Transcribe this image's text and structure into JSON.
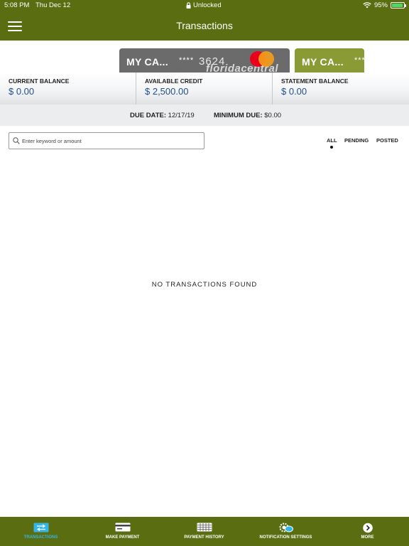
{
  "status_bar": {
    "time": "5:08 PM",
    "date": "Thu Dec 12",
    "lock_text": "Unlocked",
    "battery": "95%",
    "battery_level": 0.95
  },
  "header": {
    "title": "Transactions"
  },
  "cards": [
    {
      "name": "MY CA...",
      "mask": "****",
      "last4": "3624",
      "brand": "floridacentral"
    },
    {
      "name": "MY CA...",
      "mask": "***"
    }
  ],
  "balances": [
    {
      "label": "CURRENT BALANCE",
      "value": "$ 0.00"
    },
    {
      "label": "AVAILABLE CREDIT",
      "value": "$ 2,500.00"
    },
    {
      "label": "STATEMENT BALANCE",
      "value": "$ 0.00"
    }
  ],
  "due": {
    "due_label": "DUE DATE:",
    "due_value": "12/17/19",
    "min_label": "MINIMUM DUE:",
    "min_value": "$0.00"
  },
  "search": {
    "placeholder": "Enter keyword or amount",
    "value": ""
  },
  "filters": {
    "all": "ALL",
    "pending": "PENDING",
    "posted": "POSTED",
    "selected": "ALL"
  },
  "empty_message": "NO TRANSACTIONS FOUND",
  "tabs": [
    {
      "label": "TRANSACTIONS",
      "icon": "transactions-icon",
      "active": true
    },
    {
      "label": "MAKE PAYMENT",
      "icon": "card-icon",
      "active": false
    },
    {
      "label": "PAYMENT HISTORY",
      "icon": "calendar-icon",
      "active": false
    },
    {
      "label": "NOTIFICATION SETTINGS",
      "icon": "gear-chat-icon",
      "active": false
    },
    {
      "label": "MORE",
      "icon": "chevron-right-circle-icon",
      "active": false
    }
  ],
  "colors": {
    "header": "#5a6d10",
    "card_primary": "#6b6b6b",
    "card_secondary": "#8a9a34",
    "balance_value": "#1f4e8c",
    "tab_active": "#33b5e8"
  }
}
